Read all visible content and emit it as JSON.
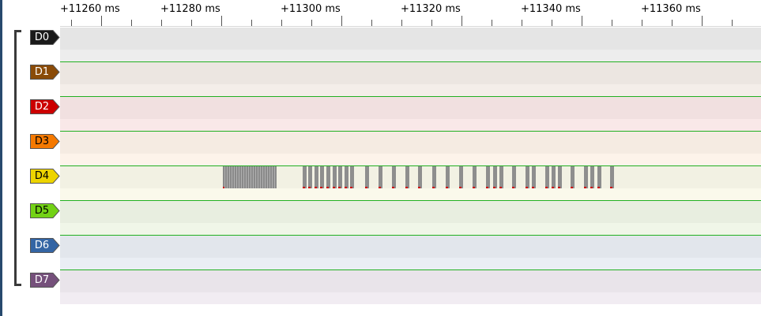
{
  "ruler": {
    "labels": [
      "+11260 ms",
      "+11280 ms",
      "+11300 ms",
      "+11320 ms",
      "+11340 ms",
      "+11360 ms"
    ]
  },
  "channels": [
    {
      "name": "D0",
      "color": "#1a1a1a",
      "text_color": "#ffffff",
      "band": "#e5e5e5",
      "state": "low"
    },
    {
      "name": "D1",
      "color": "#8a4b08",
      "text_color": "#ffffff",
      "band": "#ece6e1",
      "state": "high"
    },
    {
      "name": "D2",
      "color": "#cc0000",
      "text_color": "#ffffff",
      "band": "#f1e0e0",
      "state": "high"
    },
    {
      "name": "D3",
      "color": "#f57900",
      "text_color": "#000000",
      "band": "#f5ebe2",
      "state": "high"
    },
    {
      "name": "D4",
      "color": "#edd400",
      "text_color": "#000000",
      "band": "#f2f1e3",
      "state": "high-with-activity"
    },
    {
      "name": "D5",
      "color": "#73d216",
      "text_color": "#000000",
      "band": "#e8eee0",
      "state": "high"
    },
    {
      "name": "D6",
      "color": "#3465a4",
      "text_color": "#ffffff",
      "band": "#e2e6ec",
      "state": "high"
    },
    {
      "name": "D7",
      "color": "#75507b",
      "text_color": "#ffffff",
      "band": "#e9e4ea",
      "state": "high"
    }
  ],
  "d4_activity_ms": {
    "dense_burst": [
      11280.2,
      11289.2
    ],
    "pulses": [
      11293.5,
      11294.5,
      11295.5,
      11296.5,
      11297.5,
      11298.5,
      11299.5,
      11300.5,
      11301.5,
      11303.9,
      11306.2,
      11308.4,
      11310.6,
      11312.8,
      11315.1,
      11317.4,
      11319.6,
      11321.8,
      11324.1,
      11325.2,
      11326.3,
      11328.4,
      11330.6,
      11331.7,
      11333.9,
      11335.0,
      11336.1,
      11338.2,
      11340.4,
      11341.5,
      11342.6,
      11344.7
    ]
  }
}
